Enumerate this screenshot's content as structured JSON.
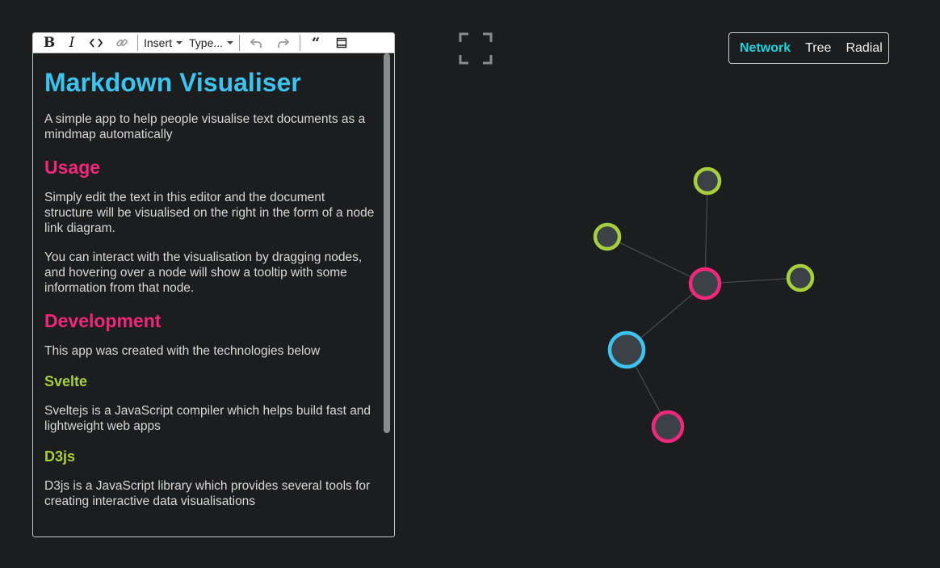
{
  "toolbar": {
    "bold_label": "B",
    "italic_label": "I",
    "insert_label": "Insert",
    "type_label": "Type...",
    "quote_label": "“"
  },
  "document": {
    "title": "Markdown Visualiser",
    "intro": "A simple app to help people visualise text documents as a mindmap automatically",
    "usage_heading": "Usage",
    "usage_p1": "Simply edit the text in this editor and the document structure will be visualised on the right in the form of a node link diagram.",
    "usage_p2": "You can interact with the visualisation by dragging nodes, and hovering over a node will show a tooltip with some information from that node.",
    "dev_heading": "Development",
    "dev_p1": "This app was created with the technologies below",
    "svelte_heading": "Svelte",
    "svelte_p": "Sveltejs is a JavaScript compiler which helps build fast and lightweight web apps",
    "d3_heading": "D3js",
    "d3_p": "D3js is a JavaScript library which provides several tools for creating interactive data visualisations"
  },
  "layout_switch": {
    "network": "Network",
    "tree": "Tree",
    "radial": "Radial",
    "active": "network"
  },
  "colors": {
    "h1": "#3ec2ee",
    "h2": "#f0287c",
    "h3": "#a7cf3c",
    "active_tab": "#1fd4dc",
    "node_fill": "#3b4247",
    "link": "#4a4e52"
  }
}
